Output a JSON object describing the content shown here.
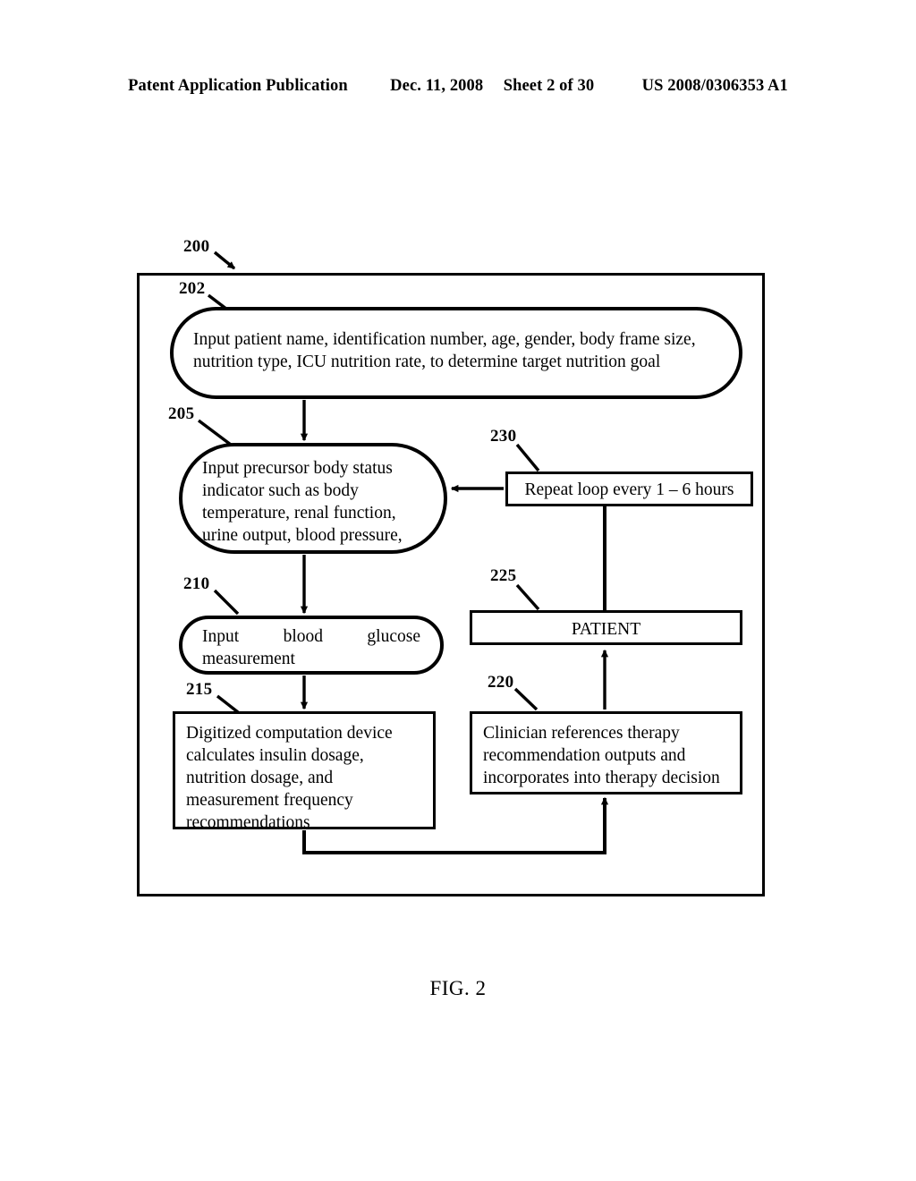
{
  "header": {
    "publication": "Patent Application Publication",
    "date": "Dec. 11, 2008",
    "sheet": "Sheet 2 of 30",
    "patent_number": "US 2008/0306353 A1"
  },
  "figure": {
    "caption": "FIG. 2",
    "system_ref": "200"
  },
  "diagram": {
    "type": "flowchart",
    "nodes": [
      {
        "ref": "202",
        "shape": "rounded-rectangle",
        "text": "Input patient name, identification number, age, gender, body frame size, nutrition type, ICU nutrition rate, to determine target nutrition goal"
      },
      {
        "ref": "205",
        "shape": "rounded-rectangle",
        "text": "Input precursor body status indicator such as body temperature, renal function, urine output, blood pressure,"
      },
      {
        "ref": "210",
        "shape": "rounded-rectangle",
        "text_line1": "Input blood glucose",
        "text_line2": "measurement"
      },
      {
        "ref": "215",
        "shape": "rectangle",
        "text": "Digitized computation device calculates insulin dosage, nutrition dosage, and measurement frequency recommendations"
      },
      {
        "ref": "220",
        "shape": "rectangle",
        "text": "Clinician references therapy recommendation outputs and incorporates into therapy decision"
      },
      {
        "ref": "225",
        "shape": "rectangle",
        "text": "PATIENT"
      },
      {
        "ref": "230",
        "shape": "rectangle",
        "text": "Repeat loop every 1 – 6 hours"
      }
    ],
    "edges": [
      {
        "from": "202",
        "to": "205",
        "arrow": true
      },
      {
        "from": "205",
        "to": "210",
        "arrow": true
      },
      {
        "from": "210",
        "to": "215",
        "arrow": true
      },
      {
        "from": "230",
        "to": "205",
        "arrow": true
      },
      {
        "from": "230",
        "to": "225",
        "arrow": false
      },
      {
        "from": "220",
        "to": "225",
        "arrow": true
      },
      {
        "from": "215",
        "to": "220",
        "arrow": true
      }
    ]
  }
}
